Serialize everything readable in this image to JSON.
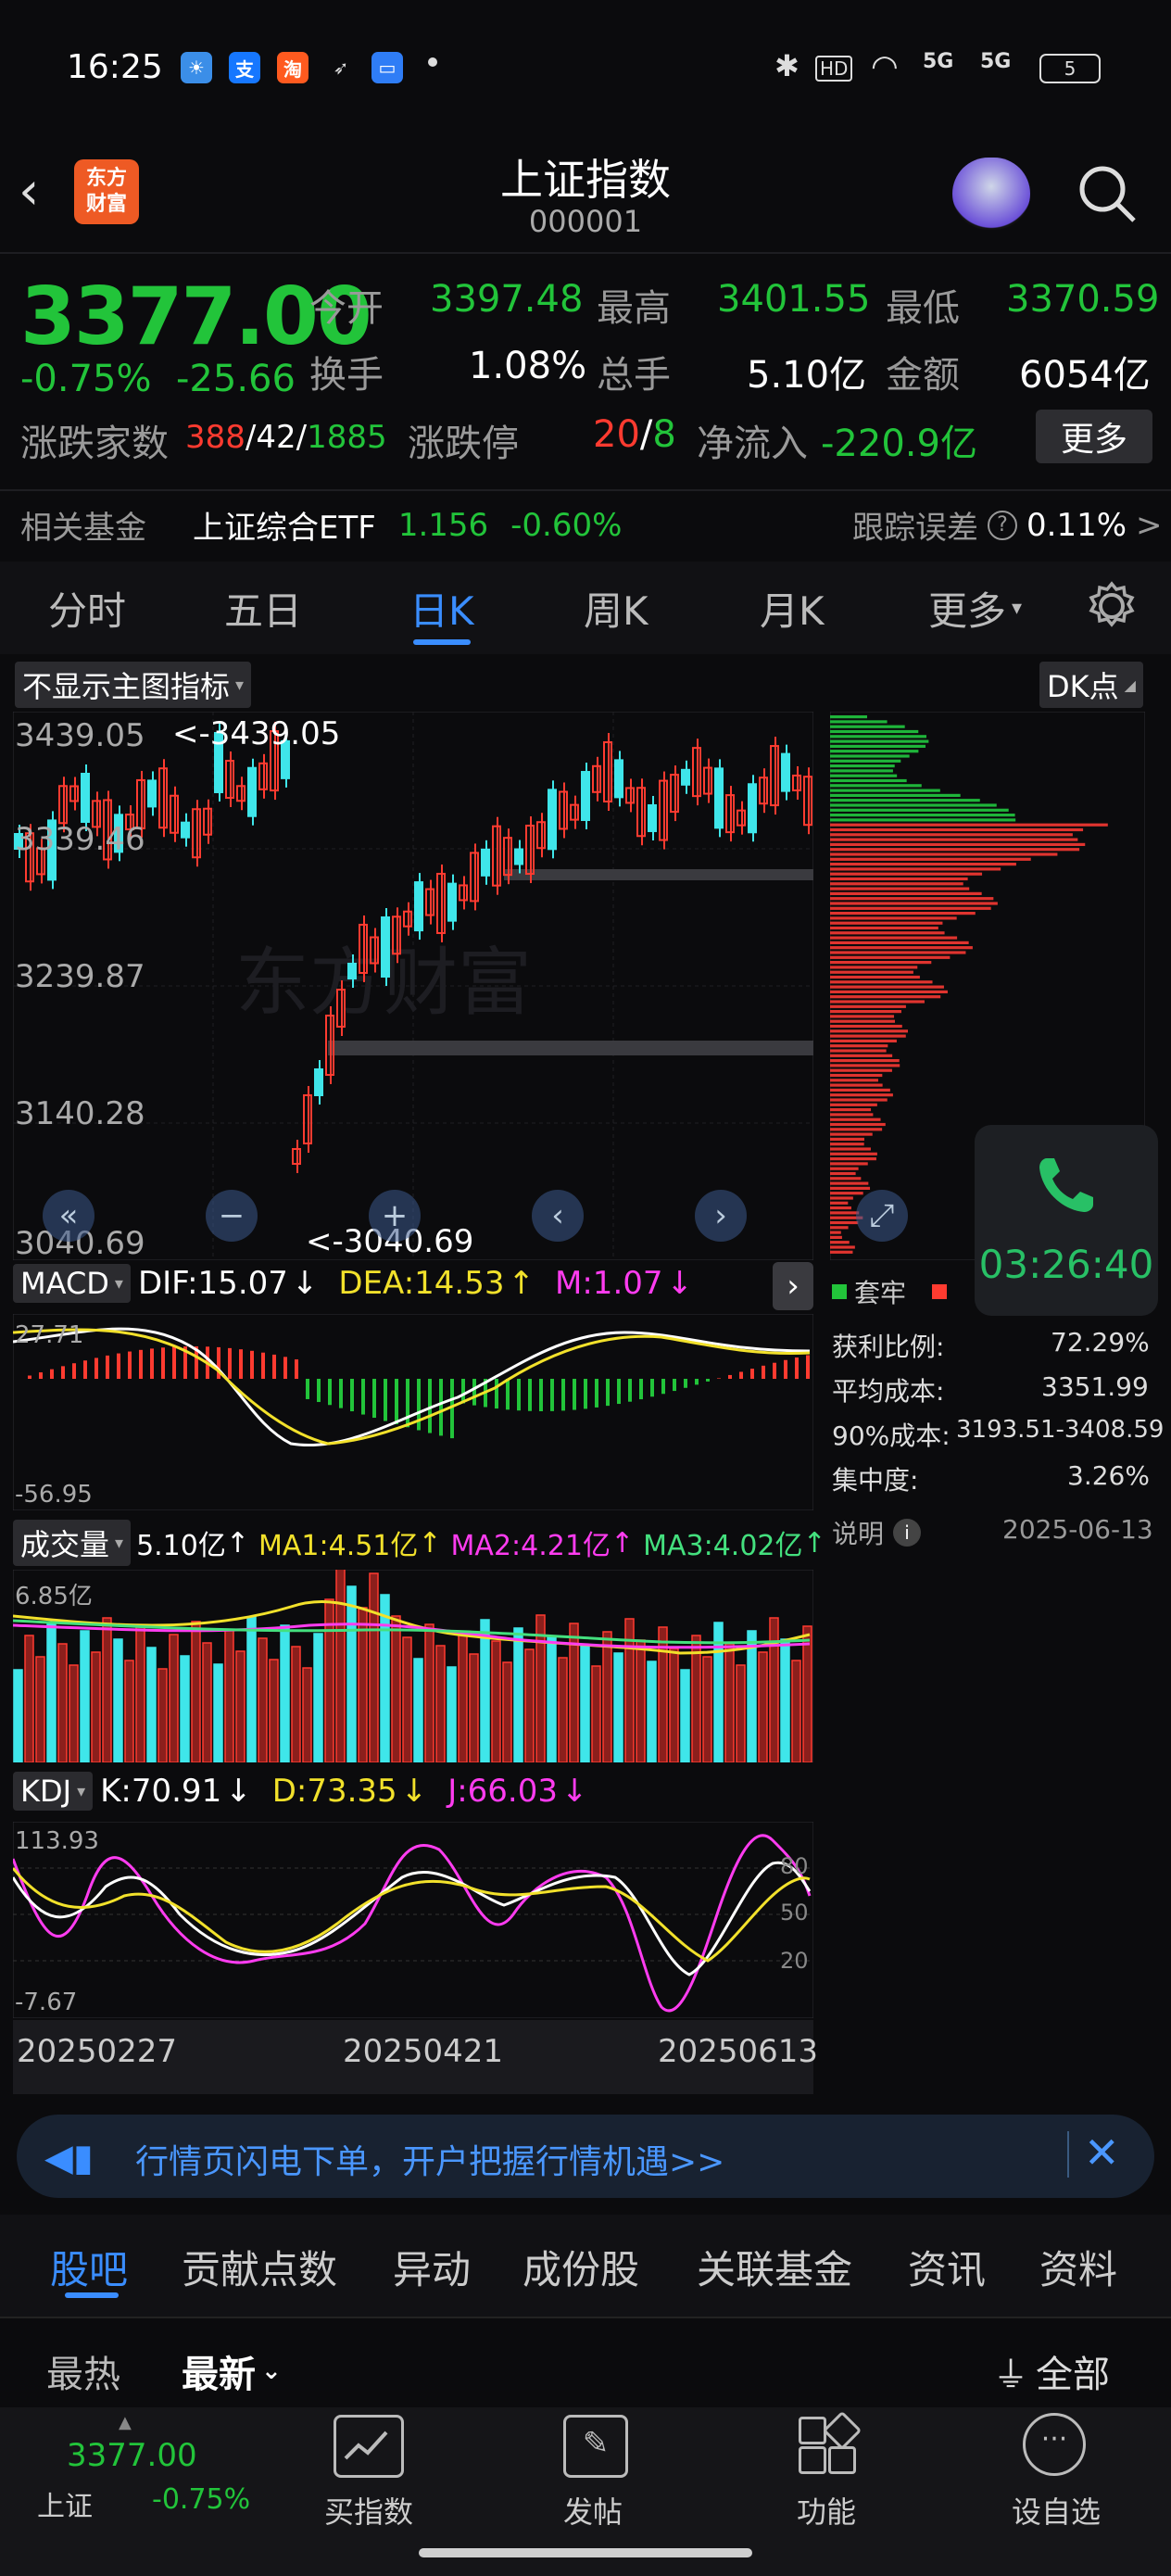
{
  "status_bar": {
    "time": "16:25",
    "battery": "5",
    "hd": "HD",
    "net1": "5G",
    "net2": "5G"
  },
  "header": {
    "logo_line1": "东方",
    "logo_line2": "财富",
    "title": "上证指数",
    "code": "000001"
  },
  "quote": {
    "price": "3377.00",
    "change_pct": "-0.75%",
    "change": "-25.66",
    "open_label": "今开",
    "open": "3397.48",
    "high_label": "最高",
    "high": "3401.55",
    "low_label": "最低",
    "low": "3370.59",
    "turnover_label": "换手",
    "turnover": "1.08%",
    "volume_label": "总手",
    "volume": "5.10亿",
    "amount_label": "金额",
    "amount": "6054亿",
    "breadth_label": "涨跌家数",
    "up": "388",
    "flat": "42",
    "down": "1885",
    "limit_label": "涨跌停",
    "limit_up": "20",
    "limit_down": "8",
    "inflow_label": "净流入",
    "inflow": "-220.9亿",
    "more": "更多"
  },
  "fund": {
    "label": "相关基金",
    "name": "上证综合ETF",
    "price": "1.156",
    "pct": "-0.60%",
    "track_label": "跟踪误差",
    "track_value": "0.11%"
  },
  "period_tabs": [
    "分时",
    "五日",
    "日K",
    "周K",
    "月K",
    "更多"
  ],
  "active_tab": "日K",
  "chart": {
    "main_indicator": "不显示主图指标",
    "dk_button": "DK点",
    "price_axis": [
      "3439.05",
      "3339.46",
      "3239.87",
      "3140.28",
      "3040.69"
    ],
    "high_marker": "<-3439.05",
    "low_marker": "<-3040.69",
    "watermark": "东方财富",
    "macd": {
      "name": "MACD",
      "dif": "DIF:15.07",
      "dea": "DEA:14.53",
      "m": "M:1.07",
      "top": "27.71",
      "bottom": "-56.95"
    },
    "volume": {
      "name": "成交量",
      "vol": "5.10亿",
      "ma1": "MA1:4.51亿",
      "ma2": "MA2:4.21亿",
      "ma3": "MA3:4.02亿",
      "top": "6.85亿"
    },
    "kdj": {
      "name": "KDJ",
      "k": "K:70.91",
      "d": "D:73.35",
      "j": "J:66.03",
      "top": "113.93",
      "bottom": "-7.67",
      "l80": "80",
      "l50": "50",
      "l20": "20"
    },
    "dates": [
      "20250227",
      "20250421",
      "20250613"
    ]
  },
  "chip": {
    "legend1": "套牢",
    "profit_label": "获利比例:",
    "profit": "72.29%",
    "avgcost_label": "平均成本:",
    "avgcost": "3351.99",
    "cost90_label": "90%成本:",
    "cost90": "3193.51-3408.59",
    "conc_label": "集中度:",
    "conc": "3.26%",
    "note_label": "说明",
    "date": "2025-06-13"
  },
  "call_widget": {
    "timer": "03:26:40"
  },
  "banner": {
    "text": "行情页闪电下单，开户把握行情机遇>>"
  },
  "feature_tabs": [
    "股吧",
    "贡献点数",
    "异动",
    "成份股",
    "关联基金",
    "资讯",
    "资料"
  ],
  "active_feature": "股吧",
  "sort": {
    "hot": "最热",
    "latest": "最新",
    "filter": "全部"
  },
  "bottom_nav": {
    "price": "3377.00",
    "name": "上证",
    "pct": "-0.75%",
    "items": [
      "买指数",
      "发帖",
      "功能",
      "设自选"
    ]
  },
  "colors": {
    "up": "#ff3b30",
    "down": "#22c43a",
    "cyan": "#3fe6ea",
    "accent": "#3a8dff"
  }
}
